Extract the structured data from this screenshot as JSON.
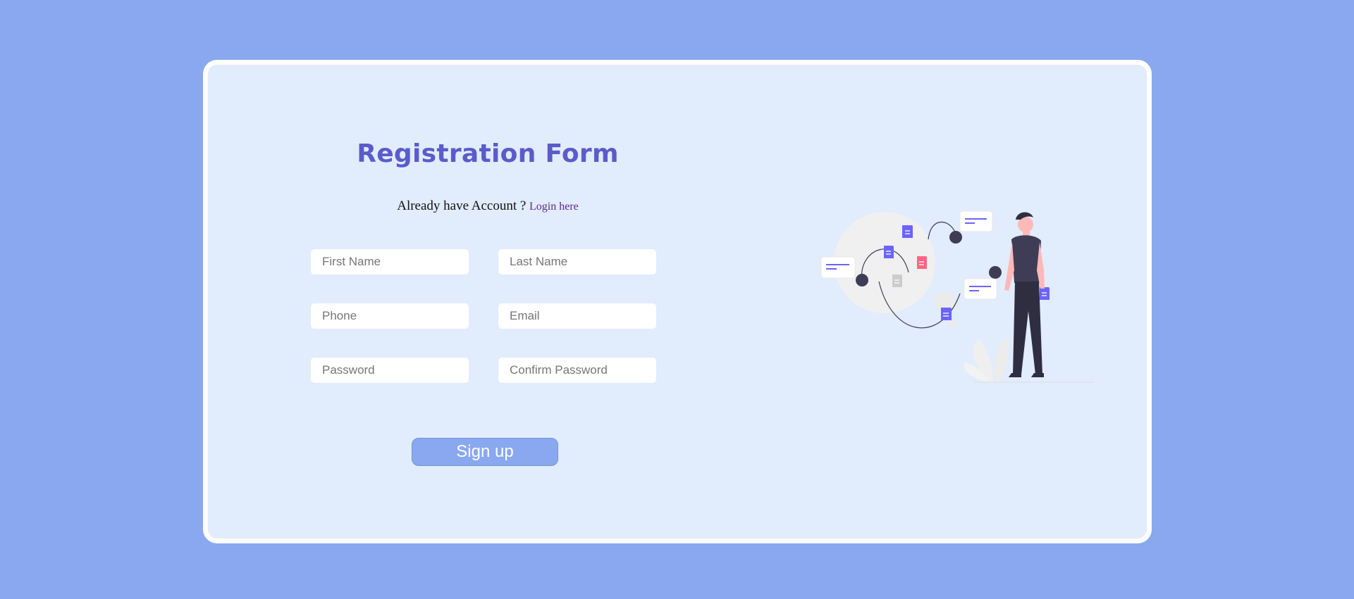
{
  "form": {
    "title": "Registration Form",
    "login_prompt": "Already have Account ?",
    "login_link": "Login here",
    "fields": {
      "first_name": {
        "placeholder": "First Name"
      },
      "last_name": {
        "placeholder": "Last Name"
      },
      "phone": {
        "placeholder": "Phone"
      },
      "email": {
        "placeholder": "Email"
      },
      "password": {
        "placeholder": "Password"
      },
      "confirm_password": {
        "placeholder": "Confirm Password"
      }
    },
    "submit_label": "Sign up"
  },
  "colors": {
    "page_background": "#89a8ef",
    "card_background": "#e1ecfc",
    "title": "#5b5bcb",
    "illustration_accent": "#6c63ff",
    "illustration_dark": "#3f3d56"
  },
  "illustration": {
    "icon": "person-with-documents-illustration"
  }
}
